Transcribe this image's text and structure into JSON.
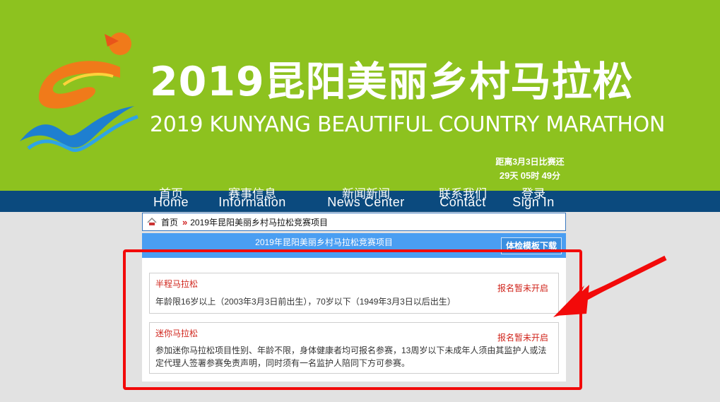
{
  "banner": {
    "title_cn": "2019昆阳美丽乡村马拉松",
    "title_en": "2019 KUNYANG BEAUTIFUL COUNTRY MARATHON",
    "countdown_label": "距离3月3日比赛还",
    "countdown_days": "29",
    "countdown_days_unit": "天",
    "countdown_hours": "05",
    "countdown_hours_unit": "时",
    "countdown_minutes": "49",
    "countdown_minutes_unit": "分",
    "colors": {
      "background": "#8dc21f",
      "logo_orange": "#f07a1a",
      "logo_blue": "#1e7fd0"
    }
  },
  "nav": {
    "items": [
      {
        "cn": "首页",
        "en": "Home"
      },
      {
        "cn": "赛事信息",
        "en": "Information"
      },
      {
        "cn": "新闻新闻",
        "en": "News Center"
      },
      {
        "cn": "联系我们",
        "en": "Contact"
      },
      {
        "cn": "登录",
        "en": "Sign In"
      }
    ],
    "color": "#0b4a7e"
  },
  "breadcrumb": {
    "home": "首页",
    "separator": "»",
    "current": "2019年昆阳美丽乡村马拉松竞赛项目"
  },
  "section": {
    "title": "2019年昆阳美丽乡村马拉松竞赛项目",
    "download_label": "体检模板下载"
  },
  "events": [
    {
      "name": "半程马拉松",
      "status": "报名暂未开启",
      "description": "年龄限16岁以上（2003年3月3日前出生），70岁以下（1949年3月3日以后出生）"
    },
    {
      "name": "迷你马拉松",
      "status": "报名暂未开启",
      "description_line1": "参加迷你马拉松项目性别、年龄不限，身体健康者均可报名参赛，13周岁以下未成年人须由其监护人或法",
      "description_line2": "定代理人签署参赛免责声明，同时须有一名监护人陪同下方可参赛。"
    }
  ],
  "annotation": {
    "color": "#f20a0a"
  }
}
